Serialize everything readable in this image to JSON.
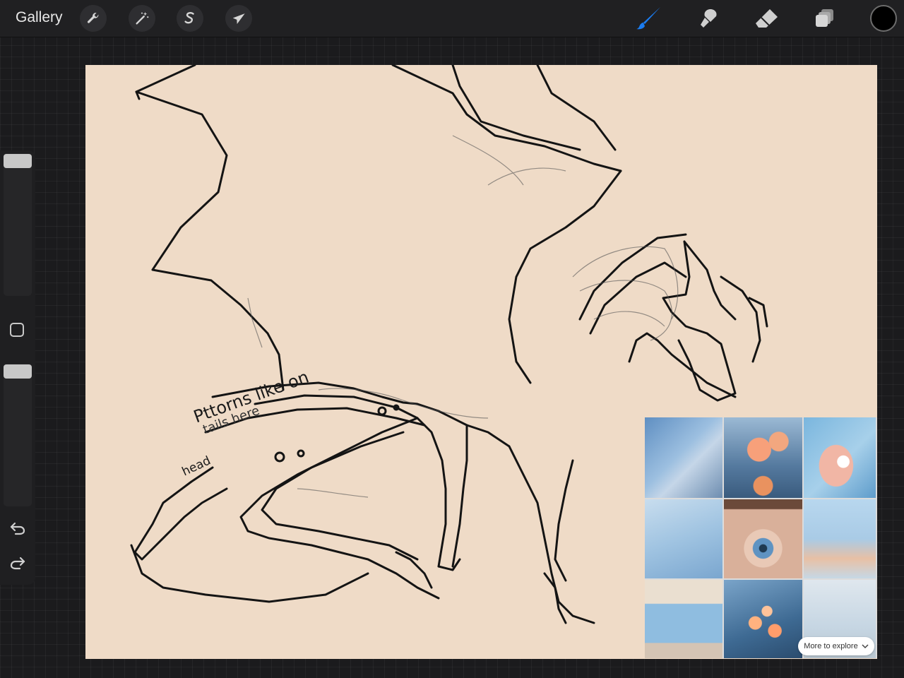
{
  "topbar": {
    "gallery_label": "Gallery",
    "left_tools": [
      {
        "name": "actions",
        "icon": "wrench-icon"
      },
      {
        "name": "adjustments",
        "icon": "magic-wand-icon"
      },
      {
        "name": "selection",
        "icon": "selection-s-icon"
      },
      {
        "name": "transform",
        "icon": "arrow-cursor-icon"
      }
    ],
    "right_tools": [
      {
        "name": "brush",
        "icon": "brush-icon",
        "active": true
      },
      {
        "name": "smudge",
        "icon": "smudge-icon"
      },
      {
        "name": "eraser",
        "icon": "eraser-icon"
      },
      {
        "name": "layers",
        "icon": "layers-icon"
      }
    ],
    "accent_color": "#1b7cf0",
    "current_color": "#000000"
  },
  "sidebar": {
    "brush_size_level": 0.95,
    "opacity_level": 0.95,
    "undo_icon": "undo-icon",
    "redo_icon": "redo-icon",
    "modify_icon": "square-icon"
  },
  "canvas": {
    "background_color": "#efdbc7",
    "note": {
      "line1": "Pttorns like on",
      "line2": "tails here",
      "line3": "head"
    }
  },
  "moodboard": {
    "more_label": "More to explore",
    "chevron_icon": "chevron-down-icon"
  }
}
